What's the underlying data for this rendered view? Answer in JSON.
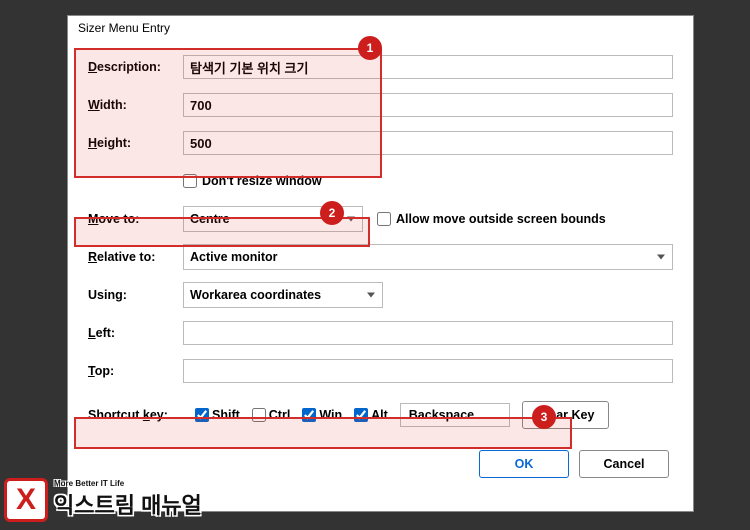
{
  "window": {
    "title": "Sizer Menu Entry"
  },
  "fields": {
    "description_label": "Description:",
    "description_value": "탐색기 기본 위치 크기",
    "width_label": "Width:",
    "width_value": "700",
    "height_label": "Height:",
    "height_value": "500",
    "dont_resize_label": "Don't resize window",
    "moveto_label": "Move to:",
    "moveto_value": "Centre",
    "allow_outside_label": "Allow move outside screen bounds",
    "relative_label": "Relative to:",
    "relative_value": "Active monitor",
    "using_label": "Using:",
    "using_value": "Workarea coordinates",
    "left_label": "Left:",
    "left_value": "",
    "top_label": "Top:",
    "top_value": "",
    "shortcut_label": "Shortcut key:",
    "shift_label": "Shift",
    "ctrl_label": "Ctrl",
    "win_label": "Win",
    "alt_label": "Alt",
    "key_value": "Backspace",
    "clear_key_label": "Clear Key"
  },
  "buttons": {
    "ok": "OK",
    "cancel": "Cancel"
  },
  "annotations": {
    "b1": "1",
    "b2": "2",
    "b3": "3"
  },
  "logo": {
    "x": "X",
    "text": "익스트림 매뉴얼",
    "sub": "More Better IT Life"
  }
}
